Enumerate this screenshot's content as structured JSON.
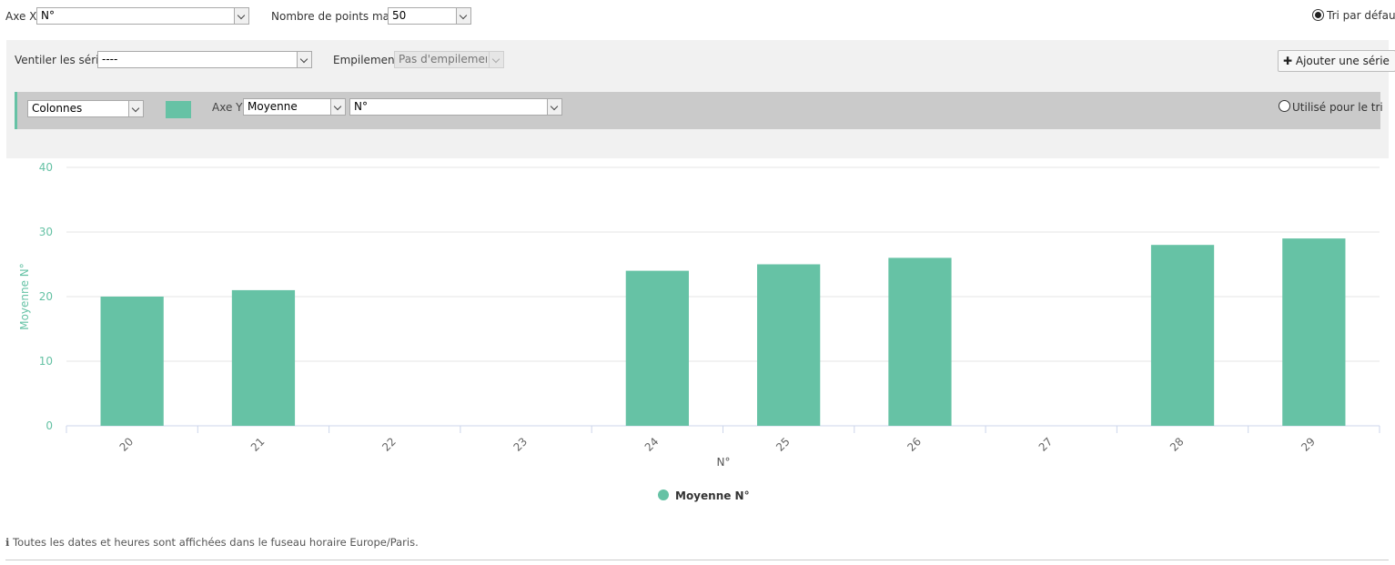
{
  "toolbar": {
    "axe_x_label": "Axe X",
    "axe_x_value": "N°",
    "max_points_label": "Nombre de points max.",
    "max_points_value": "50",
    "default_sort_label": "Tri par défaut"
  },
  "panel": {
    "split_label": "Ventiler les séries",
    "split_value": "----",
    "stacking_label": "Empilement",
    "stacking_value": "Pas d'empilement",
    "add_series_label": "Ajouter une série",
    "add_series_icon": "plus-icon"
  },
  "series": {
    "type_value": "Colonnes",
    "color": "#66c2a5",
    "axe_y_label": "Axe Y",
    "aggregate_value": "Moyenne",
    "field_value": "N°",
    "sort_label": "Utilisé pour le tri"
  },
  "chart_data": {
    "type": "bar",
    "categories": [
      "20",
      "21",
      "22",
      "23",
      "24",
      "25",
      "26",
      "27",
      "28",
      "29"
    ],
    "series": [
      {
        "name": "Moyenne N°",
        "values": [
          20,
          21,
          null,
          null,
          24,
          25,
          26,
          null,
          28,
          29
        ],
        "color": "#66c2a5"
      }
    ],
    "xlabel": "N°",
    "ylabel": "Moyenne N°",
    "ylim": [
      0,
      40
    ],
    "yticks": [
      0,
      10,
      20,
      30,
      40
    ],
    "grid": true,
    "legend": "bottom-center"
  },
  "footer": {
    "info_icon": "info-icon",
    "text": "Toutes les dates et heures sont affichées dans le fuseau horaire Europe/Paris."
  }
}
